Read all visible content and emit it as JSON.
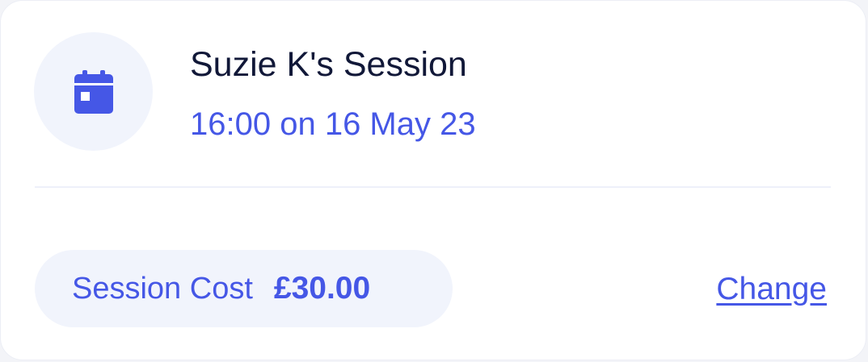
{
  "session": {
    "title": "Suzie K's Session",
    "datetime": "16:00 on 16 May 23",
    "icon": "calendar-icon"
  },
  "cost": {
    "label": "Session Cost",
    "value": "£30.00"
  },
  "actions": {
    "change_label": "Change"
  },
  "colors": {
    "accent": "#4557e6",
    "title_text": "#111838",
    "pill_background": "#f1f4fc",
    "card_background": "#ffffff"
  }
}
